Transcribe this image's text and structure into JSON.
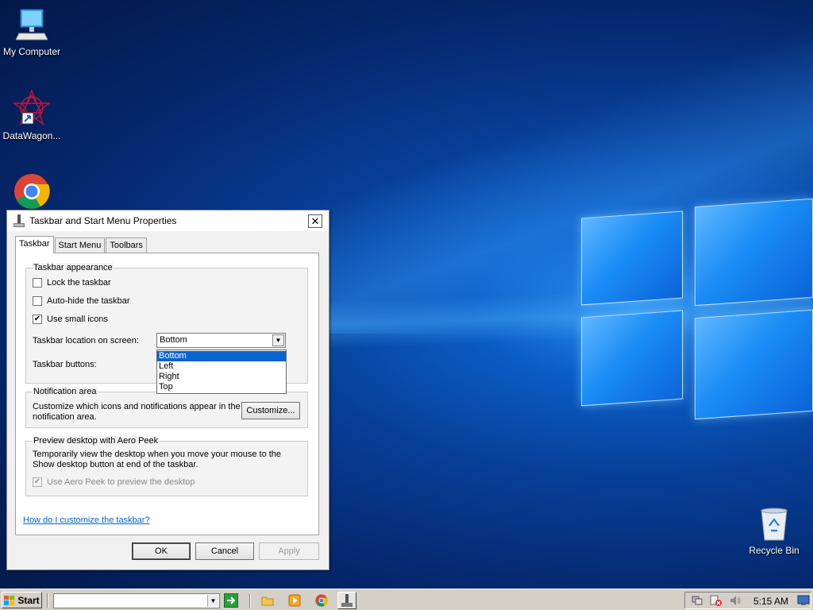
{
  "desktop": {
    "icons": [
      {
        "label": "My Computer"
      },
      {
        "label": "DataWagon..."
      },
      {
        "label": ""
      },
      {
        "label": "Recycle Bin"
      }
    ]
  },
  "dialog": {
    "title": "Taskbar and Start Menu Properties",
    "close_label": "✕",
    "tabs": [
      {
        "label": "Taskbar"
      },
      {
        "label": "Start Menu"
      },
      {
        "label": "Toolbars"
      }
    ],
    "appearance": {
      "title": "Taskbar appearance",
      "lock_label": "Lock the taskbar",
      "autohide_label": "Auto-hide the taskbar",
      "small_icons_label": "Use small icons",
      "location_label": "Taskbar location on screen:",
      "location_value": "Bottom",
      "location_options": [
        "Bottom",
        "Left",
        "Right",
        "Top"
      ],
      "buttons_label": "Taskbar buttons:"
    },
    "notification": {
      "title": "Notification area",
      "text": "Customize which icons and notifications appear in the notification area.",
      "customize_label": "Customize..."
    },
    "aero": {
      "title": "Preview desktop with Aero Peek",
      "text": "Temporarily view the desktop when you move your mouse to the Show desktop button at end of the taskbar.",
      "checkbox_label": "Use Aero Peek to preview the desktop"
    },
    "help_link": "How do I customize the taskbar?",
    "ok_label": "OK",
    "cancel_label": "Cancel",
    "apply_label": "Apply"
  },
  "taskbar": {
    "start_label": "Start",
    "clock": "5:15 AM"
  },
  "colors": {
    "selection": "#0a64d0",
    "link": "#0066cc"
  }
}
